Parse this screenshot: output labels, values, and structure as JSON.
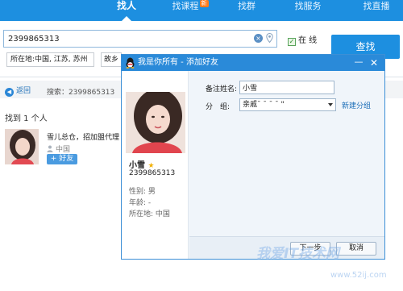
{
  "nav": {
    "tabs": [
      {
        "label": "找人",
        "active": true
      },
      {
        "label": "找课程",
        "badge": "新"
      },
      {
        "label": "找群"
      },
      {
        "label": "找服务"
      },
      {
        "label": "找直播"
      }
    ]
  },
  "search": {
    "query": "2399865313",
    "online_label": "在 线",
    "online_checked": true,
    "find_button": "查找",
    "location": "所在地:中国, 江苏, 苏州",
    "reason": "故乡"
  },
  "results": {
    "back_label": "返回",
    "search_label": "搜索：2399865313",
    "found_text": "找到 1 个人",
    "item": {
      "name": "雪儿总仓，招加盟代理",
      "location": "中国",
      "add_button": "+ 好友"
    }
  },
  "dialog": {
    "title": "我是你所有 - 添加好友",
    "minimize_symbol": "—",
    "close_symbol": "✕",
    "profile": {
      "name": "小雪",
      "qq": "2399865313",
      "gender": "性别: 男",
      "age": "年龄: -",
      "location": "所在地: 中国"
    },
    "form": {
      "remark_label": "备注姓名:",
      "remark_value": "小雪",
      "group_label": "分　组:",
      "group_value": "亲戚ˉ  ˉ ˉ ˉ \"",
      "new_group": "新建分组"
    },
    "next_button": "下一步",
    "cancel_button": "取消"
  },
  "watermark": {
    "text": "我爱IT技术网",
    "url": "www.52ij.com"
  },
  "colors": {
    "nav_blue": "#1d8fe0",
    "title_blue": "#2a8ad9",
    "link_blue": "#1d6fb8"
  }
}
